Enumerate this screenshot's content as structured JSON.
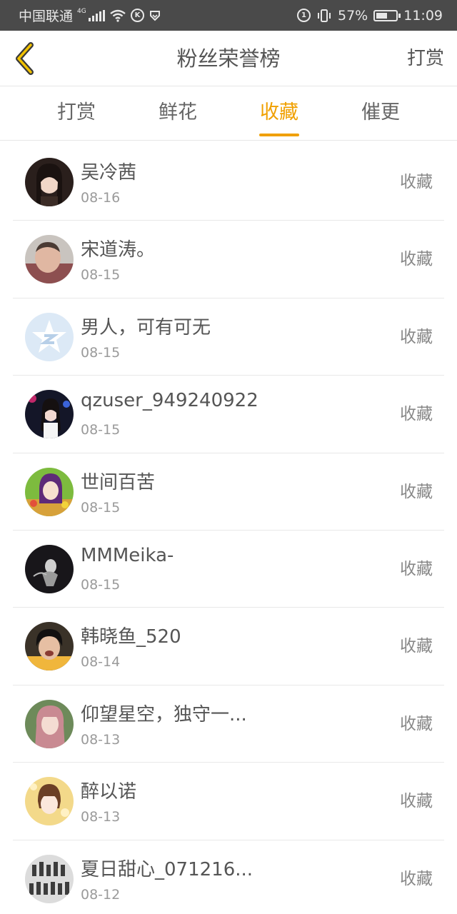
{
  "status_bar": {
    "carrier": "中国联通",
    "network": "4G",
    "battery": "57%",
    "battery_level": 0.57,
    "time": "11:09"
  },
  "header": {
    "title": "粉丝荣誉榜",
    "action_label": "打赏"
  },
  "tabs": [
    {
      "label": "打赏",
      "active": false
    },
    {
      "label": "鲜花",
      "active": false
    },
    {
      "label": "收藏",
      "active": true
    },
    {
      "label": "催更",
      "active": false
    }
  ],
  "colors": {
    "accent": "#f0a000",
    "status_bar_bg": "#4a4a4a"
  },
  "list": [
    {
      "name": "吴冷茜",
      "date": "08-16",
      "action": "收藏",
      "avatar": "portrait-woman-dark-hair"
    },
    {
      "name": "宋道涛。",
      "date": "08-15",
      "action": "收藏",
      "avatar": "portrait-man"
    },
    {
      "name": "男人，可有可无",
      "date": "08-15",
      "action": "收藏",
      "avatar": "qzone-default-star"
    },
    {
      "name": "qzuser_949240922",
      "date": "08-15",
      "action": "收藏",
      "avatar": "woman-dark-background"
    },
    {
      "name": "世间百苦",
      "date": "08-15",
      "action": "收藏",
      "avatar": "cartoon-girl-purple"
    },
    {
      "name": "MMMeika-",
      "date": "08-15",
      "action": "收藏",
      "avatar": "figure-dark-background"
    },
    {
      "name": "韩晓鱼_520",
      "date": "08-14",
      "action": "收藏",
      "avatar": "portrait-young-man"
    },
    {
      "name": "仰望星空，独守一...",
      "date": "08-13",
      "action": "收藏",
      "avatar": "woman-pink-hair"
    },
    {
      "name": "醉以诺",
      "date": "08-13",
      "action": "收藏",
      "avatar": "cartoon-girl-yellow"
    },
    {
      "name": "夏日甜心_071216...",
      "date": "08-12",
      "action": "收藏",
      "avatar": "group-photo"
    }
  ]
}
